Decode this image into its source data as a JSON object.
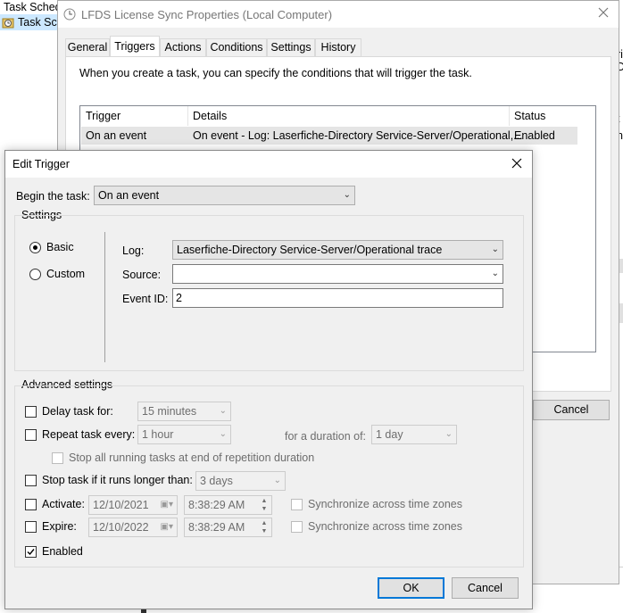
{
  "background": {
    "ts_title": "Task Sched",
    "ts_tree_item": "Task Sch",
    "right_frag_1": "ri",
    "right_frag_2": "D",
    "right_frag_3": "t",
    "right_frag_4": "n"
  },
  "props": {
    "title": "LFDS License Sync Properties (Local Computer)",
    "tabs": [
      "General",
      "Triggers",
      "Actions",
      "Conditions",
      "Settings",
      "History"
    ],
    "description": "When you create a task, you can specify the conditions that will trigger the task.",
    "table": {
      "headers": [
        "Trigger",
        "Details",
        "Status"
      ],
      "rows": [
        {
          "trigger": "On an event",
          "details": "On event - Log: Laserfiche-Directory Service-Server/Operational,...",
          "status": "Enabled"
        }
      ]
    },
    "cancel_label": "Cancel"
  },
  "dialog": {
    "title": "Edit Trigger",
    "begin_label": "Begin the task:",
    "begin_value": "On an event",
    "settings_label": "Settings",
    "basic_label": "Basic",
    "custom_label": "Custom",
    "log_label": "Log:",
    "log_value": "Laserfiche-Directory Service-Server/Operational trace",
    "source_label": "Source:",
    "source_value": "",
    "eventid_label": "Event ID:",
    "eventid_value": "2",
    "advanced_label": "Advanced settings",
    "delay_label": "Delay task for:",
    "delay_value": "15 minutes",
    "repeat_label": "Repeat task every:",
    "repeat_value": "1 hour",
    "duration_label": "for a duration of:",
    "duration_value": "1 day",
    "stopall_label": "Stop all running tasks at end of repetition duration",
    "stoplonger_label": "Stop task if it runs longer than:",
    "stoplonger_value": "3 days",
    "activate_label": "Activate:",
    "activate_date": "12/10/2021",
    "activate_time": "8:38:29 AM",
    "expire_label": "Expire:",
    "expire_date": "12/10/2022",
    "expire_time": "8:38:29 AM",
    "sync_label": "Synchronize across time zones",
    "enabled_label": "Enabled",
    "ok_label": "OK",
    "cancel_label": "Cancel"
  },
  "colors": {
    "accent": "#0078d7",
    "dialog_bg": "#f0f0f0"
  },
  "icons": {
    "close": "close-icon",
    "clock": "clock-icon",
    "dropdown": "chevron-down-icon",
    "check": "check-icon"
  }
}
